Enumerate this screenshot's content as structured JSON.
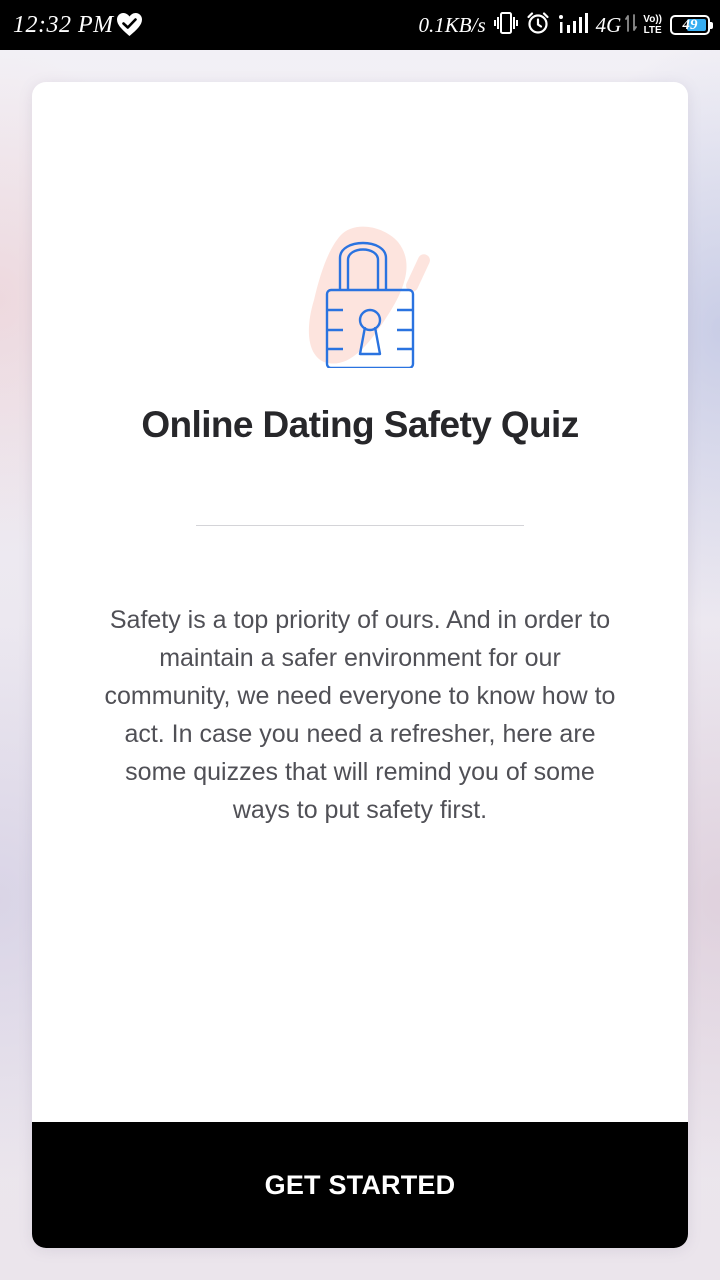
{
  "status_bar": {
    "time": "12:32 PM",
    "net_speed": "0.1KB/s",
    "network_type": "4G",
    "volte_top": "Vo))",
    "volte_bottom": "LTE",
    "battery_level": "49",
    "icons": [
      "heart-check-icon",
      "vibrate-icon",
      "alarm-icon",
      "signal-icon",
      "data-arrows-icon",
      "volte-icon",
      "battery-icon"
    ]
  },
  "quiz": {
    "icon": "padlock-icon",
    "accent_color": "#2a73e0",
    "blob_color": "#fde4de",
    "title": "Online Dating Safety Quiz",
    "description": "Safety is a top priority of ours. And in order to maintain a safer environment for our community, we need everyone to know how to act. In case you need a refresher, here are some quizzes that will remind you of some ways to put safety first.",
    "button_label": "GET STARTED"
  }
}
